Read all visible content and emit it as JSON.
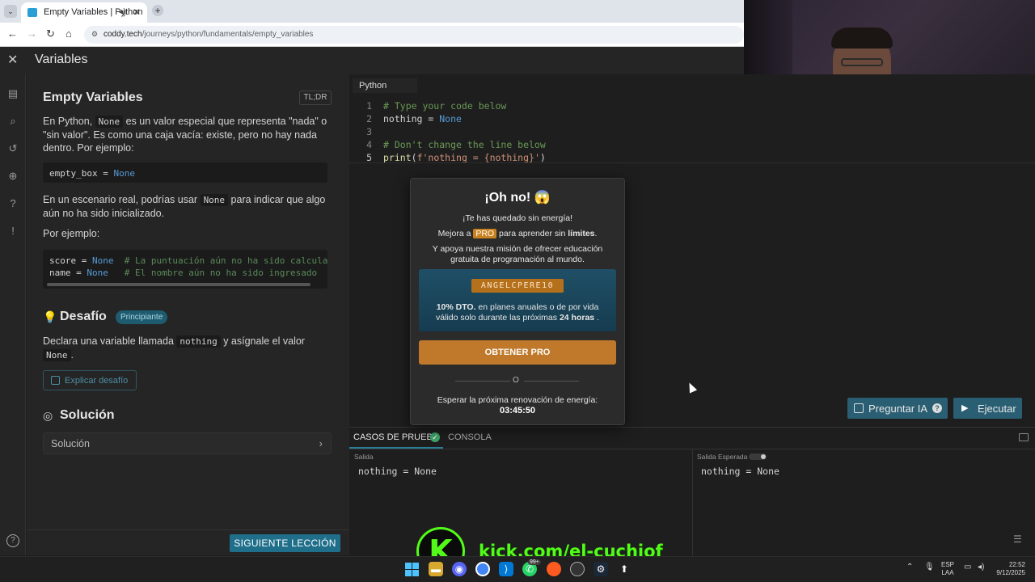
{
  "browser": {
    "tab_title": "Empty Variables | Python",
    "url_host": "coddy.tech",
    "url_path": "/journeys/python/fundamentals/empty_variables"
  },
  "app": {
    "title": "Variables"
  },
  "lesson": {
    "title": "Empty Variables",
    "tldr": "TL;DR",
    "p1_a": "En Python, ",
    "p1_code": "None",
    "p1_b": " es un valor especial que representa \"nada\" o \"sin valor\". Es como una caja vacía: existe, pero no hay nada dentro. Por ejemplo:",
    "code1_name": "empty_box",
    "code1_eq": " = ",
    "code1_val": "None",
    "p2_a": "En un escenario real, podrías usar ",
    "p2_code": "None",
    "p2_b": " para indicar que algo aún no ha sido inicializado.",
    "p3": "Por ejemplo:",
    "code2_l1_a": "score = ",
    "code2_l1_val": "None",
    "code2_l1_cmt": "  # La puntuación aún no ha sido calcula",
    "code2_l2_a": "name = ",
    "code2_l2_val": "None",
    "code2_l2_cmt": "   # El nombre aún no ha sido ingresado",
    "desafio_title": "Desafío",
    "desafio_badge": "Principiante",
    "desafio_text_a": "Declara una variable llamada ",
    "desafio_code1": "nothing",
    "desafio_text_b": " y asígnale el valor ",
    "desafio_code2": "None",
    "desafio_text_c": ".",
    "explicar_label": "Explicar desafío",
    "solucion_title": "Solución",
    "solucion_row": "Solución",
    "next_label": "SIGUIENTE LECCIÓN"
  },
  "editor": {
    "language": "Python",
    "line_numbers": [
      "1",
      "2",
      "3",
      "4",
      "5"
    ],
    "line1": "# Type your code below",
    "line2_a": "nothing = ",
    "line2_b": "None",
    "line4": "# Don't change the line below",
    "line5_fn": "print",
    "line5_a": "(",
    "line5_str": "f'nothing = {nothing}'",
    "line5_b": ")",
    "btn_ia": "Preguntar IA",
    "btn_run": "Ejecutar"
  },
  "bottom_panel": {
    "tab_casos": "CASOS DE PRUEBA",
    "tab_consola": "CONSOLA",
    "salida_label": "Salida",
    "salida_value": "nothing = None",
    "esperada_label": "Salida Esperada",
    "esperada_value": "nothing = None"
  },
  "modal": {
    "title": "¡Oh no! 😱",
    "line1": "¡Te has quedado sin energía!",
    "line2_a": "Mejora a ",
    "line2_pro": "PRO",
    "line2_b": " para aprender sin ",
    "line2_bold": "límites",
    "line2_c": ".",
    "line3": "Y apoya nuestra misión de ofrecer educación",
    "line4": "gratuita de programación al mundo.",
    "promo_code": "ANGELCPERE10",
    "promo_bold": "10% DTO.",
    "promo_a": " en planes anuales o de por vida",
    "promo_b": "válido solo durante las próximas ",
    "promo_hours": "24 horas",
    "promo_c": " .",
    "btn_pro": "OBTENER PRO",
    "or": "O",
    "wait_label": "Esperar la próxima renovación de energía:",
    "wait_time": "03:45:50"
  },
  "overlay": {
    "kick_letter": "K",
    "kick_url": "kick.com/el-cuchiof"
  },
  "taskbar": {
    "lang_1": "ESP",
    "lang_2": "LAA",
    "time": "22:52",
    "date": "9/12/2025",
    "badge": "99+"
  },
  "colors": {
    "accent": "#1f6f8b",
    "pro_orange": "#c0792a",
    "kick_green": "#53fc18"
  }
}
